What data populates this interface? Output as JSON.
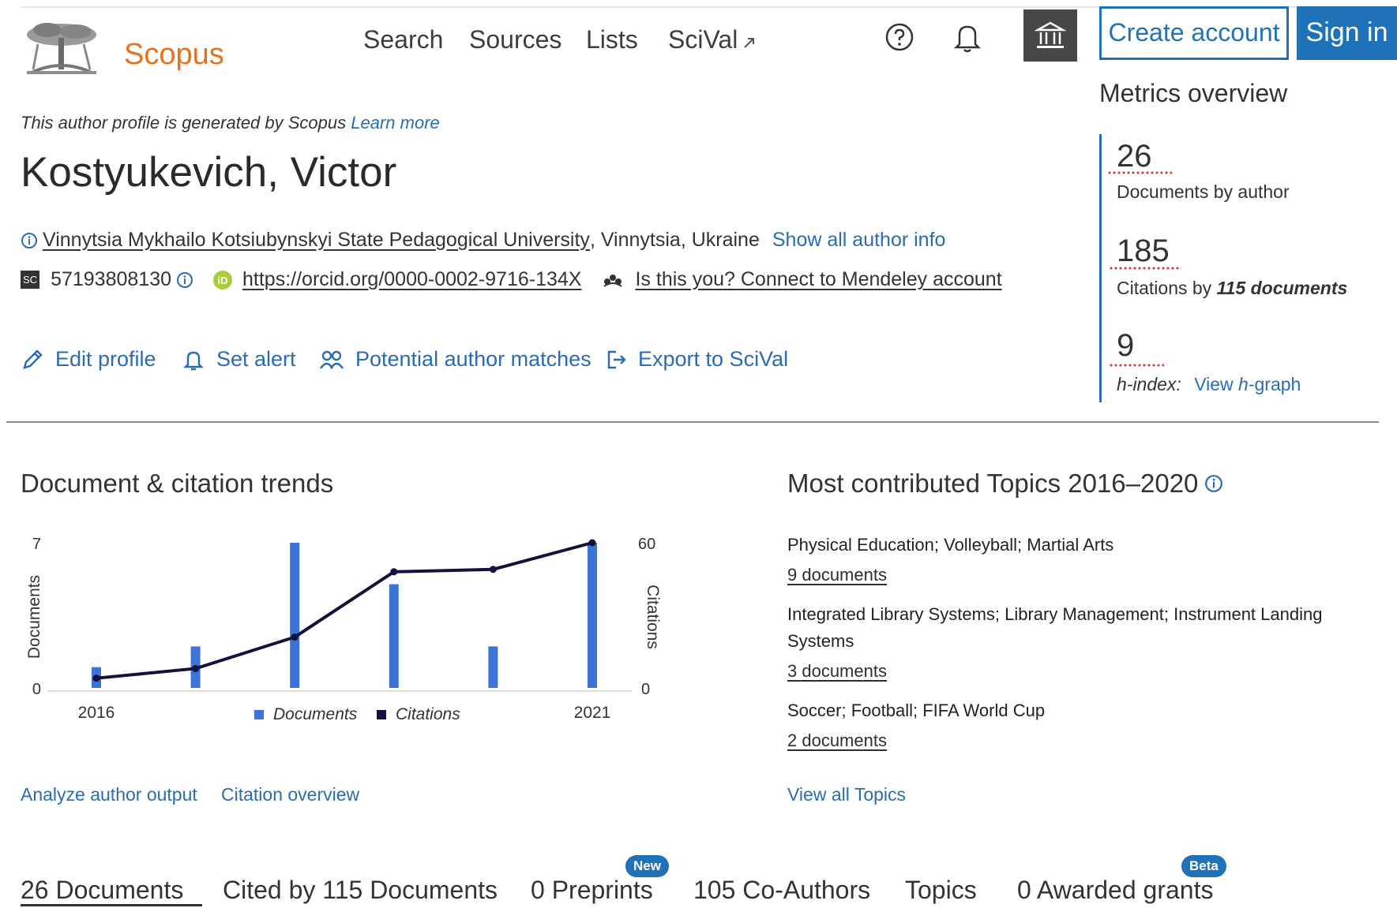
{
  "header": {
    "logo_text": "Scopus",
    "nav": [
      "Search",
      "Sources",
      "Lists",
      "SciVal"
    ],
    "create_account": "Create account",
    "sign_in": "Sign in"
  },
  "profile": {
    "generated_note": "This author profile is generated by Scopus",
    "learn_more": "Learn more",
    "name": "Kostyukevich, Victor",
    "affiliation_link": "Vinnytsia Mykhailo Kotsiubynskyi State Pedagogical University",
    "affiliation_rest": ", Vinnytsia, Ukraine",
    "show_all": "Show all author info",
    "scopus_id": "57193808130",
    "orcid": "https://orcid.org/0000-0002-9716-134X",
    "mendeley": "Is this you? Connect to Mendeley account",
    "sc_badge": "SC"
  },
  "actions": [
    "Edit profile",
    "Set alert",
    "Potential author matches",
    "Export to SciVal"
  ],
  "metrics": {
    "title": "Metrics overview",
    "documents_value": "26",
    "documents_label": "Documents by author",
    "citations_value": "185",
    "citations_label_pre": "Citations by ",
    "citations_label_bold": "115 documents",
    "hindex_value": "9",
    "hindex_label": "h-index:",
    "hindex_link_pre": "View ",
    "hindex_link_it": "h",
    "hindex_link_post": "-graph"
  },
  "trends": {
    "title": "Document & citation trends",
    "analyze_link": "Analyze author output",
    "citation_link": "Citation overview"
  },
  "chart_data": {
    "type": "bar",
    "x": [
      2016,
      2017,
      2018,
      2019,
      2020,
      2021
    ],
    "x_tick_labels": [
      "2016",
      "2021"
    ],
    "series": [
      {
        "name": "Documents",
        "type": "bar",
        "axis": "left",
        "values": [
          1,
          2,
          7,
          5,
          2,
          7
        ]
      },
      {
        "name": "Citations",
        "type": "line",
        "axis": "right",
        "values": [
          4,
          8,
          21,
          48,
          49,
          60
        ]
      }
    ],
    "ylabel_left": "Documents",
    "ylabel_right": "Citations",
    "ylim_left": [
      0,
      7
    ],
    "ylim_right": [
      0,
      60
    ],
    "left_tick_labels": [
      "0",
      "7"
    ],
    "right_tick_labels": [
      "0",
      "60"
    ],
    "legend": [
      "Documents",
      "Citations"
    ],
    "legend_position": "bottom",
    "colors": {
      "documents": "#3b73d6",
      "citations": "#12123a"
    }
  },
  "topics": {
    "title": "Most contributed Topics 2016–2020",
    "items": [
      {
        "name": "Physical Education; Volleyball; Martial Arts",
        "docs": "9 documents"
      },
      {
        "name": "Integrated Library Systems; Library Management; Instrument Landing Systems",
        "docs": "3 documents"
      },
      {
        "name": "Soccer; Football; FIFA World Cup",
        "docs": "2 documents"
      }
    ],
    "view_all": "View all Topics"
  },
  "tabs": [
    {
      "label": "26 Documents"
    },
    {
      "label": "Cited by 115 Documents"
    },
    {
      "label": "0 Preprints",
      "badge": "New"
    },
    {
      "label": "105 Co-Authors"
    },
    {
      "label": "Topics"
    },
    {
      "label": "0 Awarded grants",
      "badge": "Beta"
    }
  ],
  "colors": {
    "accent": "#1f71b8",
    "link": "#2b6cb0",
    "logo": "#e9711c",
    "orcid": "#a6ce39"
  }
}
